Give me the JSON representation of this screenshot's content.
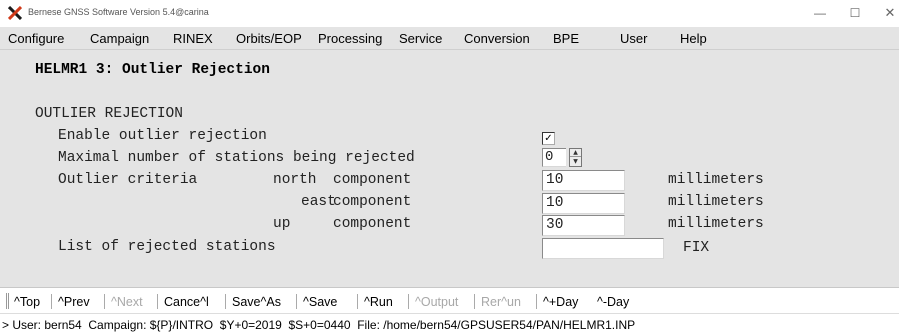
{
  "window": {
    "title": "Bernese GNSS Software Version 5.4@carina",
    "logo_icon": "bernese-x-logo-icon",
    "controls": {
      "minimize": "—",
      "maximize": "☐",
      "close": "✕"
    }
  },
  "menubar": {
    "items": [
      {
        "label": "Configure"
      },
      {
        "label": "Campaign"
      },
      {
        "label": "RINEX"
      },
      {
        "label": "Orbits/EOP"
      },
      {
        "label": "Processing"
      },
      {
        "label": "Service"
      },
      {
        "label": "Conversion"
      },
      {
        "label": "BPE"
      },
      {
        "label": "User"
      },
      {
        "label": "Help"
      }
    ]
  },
  "panel": {
    "heading": "HELMR1 3: Outlier Rejection",
    "section_title": "OUTLIER REJECTION",
    "enable_label": "Enable outlier rejection",
    "enable_checked": true,
    "enable_checkmark": "✓",
    "max_stations_label": "Maximal number of stations being rejected",
    "max_stations_value": "0",
    "spin_up_glyph": "▲",
    "spin_down_glyph": "▼",
    "criteria_label": "Outlier criteria",
    "north": {
      "axis": "north",
      "component": "component",
      "value": "10",
      "unit": "millimeters"
    },
    "east": {
      "axis": "east",
      "component": "component",
      "value": "10",
      "unit": "millimeters"
    },
    "up": {
      "axis": "up",
      "component": "component",
      "value": "30",
      "unit": "millimeters"
    },
    "rejected_label": "List of rejected stations",
    "rejected_value": "",
    "rejected_suffix": "FIX"
  },
  "toolbar": {
    "items": [
      {
        "label": "^Top",
        "enabled": true
      },
      {
        "label": "^Prev",
        "enabled": true
      },
      {
        "label": "^Next",
        "enabled": false
      },
      {
        "label": "Cance^l",
        "enabled": true
      },
      {
        "label": "Save^As",
        "enabled": true
      },
      {
        "label": "^Save",
        "enabled": true
      },
      {
        "label": "^Run",
        "enabled": true
      },
      {
        "label": "^Output",
        "enabled": false
      },
      {
        "label": "Rer^un",
        "enabled": false
      },
      {
        "label": "^+Day",
        "enabled": true
      },
      {
        "label": "^-Day",
        "enabled": true
      }
    ]
  },
  "status": {
    "text": "> User: bern54  Campaign: ${P}/INTRO  $Y+0=2019  $S+0=0440  File: /home/bern54/GPSUSER54/PAN/HELMR1.INP"
  }
}
